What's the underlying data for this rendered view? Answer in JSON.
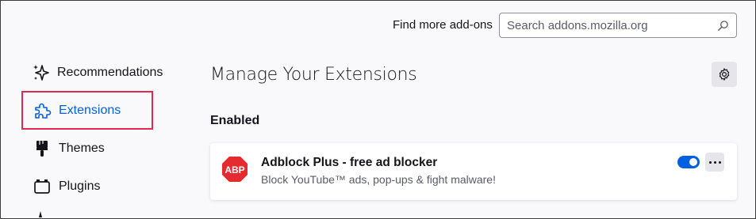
{
  "header": {
    "find_more_label": "Find more add-ons",
    "search_placeholder": "Search addons.mozilla.org"
  },
  "sidebar": {
    "items": [
      {
        "label": "Recommendations",
        "icon": "sparkle-icon"
      },
      {
        "label": "Extensions",
        "icon": "puzzle-icon",
        "active": true
      },
      {
        "label": "Themes",
        "icon": "paintbrush-icon"
      },
      {
        "label": "Plugins",
        "icon": "plugin-icon"
      }
    ]
  },
  "main": {
    "title": "Manage Your Extensions",
    "section_enabled": "Enabled",
    "extensions": [
      {
        "name": "Adblock Plus - free ad blocker",
        "description": "Block YouTube™ ads, pop-ups & fight malware!",
        "logo_text": "ABP",
        "enabled": true
      }
    ]
  },
  "colors": {
    "accent": "#0061e0",
    "highlight_border": "#e22850",
    "abp_red": "#e52b2f"
  }
}
